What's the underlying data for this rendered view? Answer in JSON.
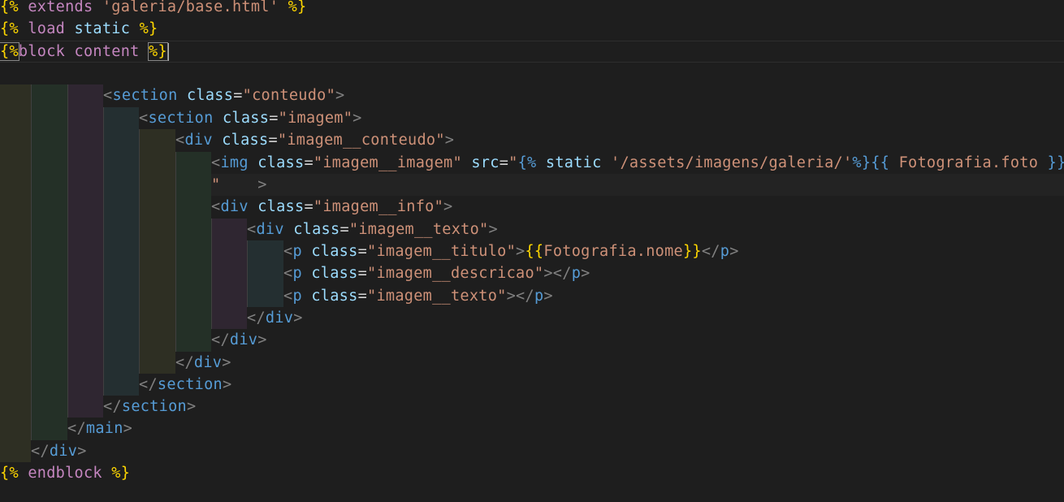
{
  "editor": {
    "lines": [
      {
        "tokens": [
          {
            "t": "{% ",
            "c": "tmpl"
          },
          {
            "t": "extends ",
            "c": "tmpl-kw"
          },
          {
            "t": "'galeria/base.html'",
            "c": "tmpl-str"
          },
          {
            "t": " %}",
            "c": "tmpl"
          }
        ]
      },
      {
        "tokens": [
          {
            "t": "{% ",
            "c": "tmpl"
          },
          {
            "t": "load ",
            "c": "tmpl-kw"
          },
          {
            "t": "static",
            "c": "tmpl-var"
          },
          {
            "t": " %}",
            "c": "tmpl"
          }
        ]
      },
      {
        "tokens": [
          {
            "t": "{%",
            "c": "tmpl"
          },
          {
            "t": "block ",
            "c": "tmpl-kw"
          },
          {
            "t": "content ",
            "c": "tmpl-kw"
          },
          {
            "t": "%}",
            "c": "tmpl"
          }
        ]
      },
      {
        "tokens": []
      },
      {
        "tokens": [
          {
            "t": "<",
            "c": "punc"
          },
          {
            "t": "section",
            "c": "kw-tag"
          },
          {
            "t": " ",
            "c": "plain"
          },
          {
            "t": "class",
            "c": "attr"
          },
          {
            "t": "=",
            "c": "plain"
          },
          {
            "t": "\"conteudo\"",
            "c": "str"
          },
          {
            "t": ">",
            "c": "punc"
          }
        ]
      },
      {
        "tokens": [
          {
            "t": "<",
            "c": "punc"
          },
          {
            "t": "section",
            "c": "kw-tag"
          },
          {
            "t": " ",
            "c": "plain"
          },
          {
            "t": "class",
            "c": "attr"
          },
          {
            "t": "=",
            "c": "plain"
          },
          {
            "t": "\"imagem\"",
            "c": "str"
          },
          {
            "t": ">",
            "c": "punc"
          }
        ]
      },
      {
        "tokens": [
          {
            "t": "<",
            "c": "punc"
          },
          {
            "t": "div",
            "c": "kw-tag"
          },
          {
            "t": " ",
            "c": "plain"
          },
          {
            "t": "class",
            "c": "attr"
          },
          {
            "t": "=",
            "c": "plain"
          },
          {
            "t": "\"imagem__conteudo\"",
            "c": "str"
          },
          {
            "t": ">",
            "c": "punc"
          }
        ]
      },
      {
        "tokens": [
          {
            "t": "<",
            "c": "punc"
          },
          {
            "t": "img",
            "c": "kw-tag"
          },
          {
            "t": " ",
            "c": "plain"
          },
          {
            "t": "class",
            "c": "attr"
          },
          {
            "t": "=",
            "c": "plain"
          },
          {
            "t": "\"imagem__imagem\"",
            "c": "str"
          },
          {
            "t": " ",
            "c": "plain"
          },
          {
            "t": "src",
            "c": "attr"
          },
          {
            "t": "=",
            "c": "plain"
          },
          {
            "t": "\"",
            "c": "str"
          },
          {
            "t": "{% ",
            "c": "kw-tag"
          },
          {
            "t": "static ",
            "c": "attr"
          },
          {
            "t": "'/assets/imagens/galeria/'",
            "c": "str"
          },
          {
            "t": "%}",
            "c": "kw-tag"
          },
          {
            "t": "{{ ",
            "c": "kw-tag"
          },
          {
            "t": "Fotografia.foto",
            "c": "str"
          },
          {
            "t": " }}",
            "c": "kw-tag"
          }
        ]
      },
      {
        "tokens": [
          {
            "t": "\"",
            "c": "str"
          },
          {
            "t": "    ",
            "c": "plain"
          },
          {
            "t": ">",
            "c": "punc"
          }
        ]
      },
      {
        "tokens": [
          {
            "t": "<",
            "c": "punc"
          },
          {
            "t": "div",
            "c": "kw-tag"
          },
          {
            "t": " ",
            "c": "plain"
          },
          {
            "t": "class",
            "c": "attr"
          },
          {
            "t": "=",
            "c": "plain"
          },
          {
            "t": "\"imagem__info\"",
            "c": "str"
          },
          {
            "t": ">",
            "c": "punc"
          }
        ]
      },
      {
        "tokens": [
          {
            "t": "<",
            "c": "punc"
          },
          {
            "t": "div",
            "c": "kw-tag"
          },
          {
            "t": " ",
            "c": "plain"
          },
          {
            "t": "class",
            "c": "attr"
          },
          {
            "t": "=",
            "c": "plain"
          },
          {
            "t": "\"imagem__texto\"",
            "c": "str"
          },
          {
            "t": ">",
            "c": "punc"
          }
        ]
      },
      {
        "tokens": [
          {
            "t": "<",
            "c": "punc"
          },
          {
            "t": "p",
            "c": "kw-tag"
          },
          {
            "t": " ",
            "c": "plain"
          },
          {
            "t": "class",
            "c": "attr"
          },
          {
            "t": "=",
            "c": "plain"
          },
          {
            "t": "\"imagem__titulo\"",
            "c": "str"
          },
          {
            "t": ">",
            "c": "punc"
          },
          {
            "t": "{{",
            "c": "tmpl"
          },
          {
            "t": "Fotografia.nome",
            "c": "str"
          },
          {
            "t": "}}",
            "c": "tmpl"
          },
          {
            "t": "</",
            "c": "punc"
          },
          {
            "t": "p",
            "c": "kw-tag"
          },
          {
            "t": ">",
            "c": "punc"
          }
        ]
      },
      {
        "tokens": [
          {
            "t": "<",
            "c": "punc"
          },
          {
            "t": "p",
            "c": "kw-tag"
          },
          {
            "t": " ",
            "c": "plain"
          },
          {
            "t": "class",
            "c": "attr"
          },
          {
            "t": "=",
            "c": "plain"
          },
          {
            "t": "\"imagem__descricao\"",
            "c": "str"
          },
          {
            "t": ">",
            "c": "punc"
          },
          {
            "t": "</",
            "c": "punc"
          },
          {
            "t": "p",
            "c": "kw-tag"
          },
          {
            "t": ">",
            "c": "punc"
          }
        ]
      },
      {
        "tokens": [
          {
            "t": "<",
            "c": "punc"
          },
          {
            "t": "p",
            "c": "kw-tag"
          },
          {
            "t": " ",
            "c": "plain"
          },
          {
            "t": "class",
            "c": "attr"
          },
          {
            "t": "=",
            "c": "plain"
          },
          {
            "t": "\"imagem__texto\"",
            "c": "str"
          },
          {
            "t": ">",
            "c": "punc"
          },
          {
            "t": "</",
            "c": "punc"
          },
          {
            "t": "p",
            "c": "kw-tag"
          },
          {
            "t": ">",
            "c": "punc"
          }
        ]
      },
      {
        "tokens": [
          {
            "t": "</",
            "c": "punc"
          },
          {
            "t": "div",
            "c": "kw-tag"
          },
          {
            "t": ">",
            "c": "punc"
          }
        ]
      },
      {
        "tokens": [
          {
            "t": "</",
            "c": "punc"
          },
          {
            "t": "div",
            "c": "kw-tag"
          },
          {
            "t": ">",
            "c": "punc"
          }
        ]
      },
      {
        "tokens": [
          {
            "t": "</",
            "c": "punc"
          },
          {
            "t": "div",
            "c": "kw-tag"
          },
          {
            "t": ">",
            "c": "punc"
          }
        ]
      },
      {
        "tokens": [
          {
            "t": "</",
            "c": "punc"
          },
          {
            "t": "section",
            "c": "kw-tag"
          },
          {
            "t": ">",
            "c": "punc"
          }
        ]
      },
      {
        "tokens": [
          {
            "t": "</",
            "c": "punc"
          },
          {
            "t": "section",
            "c": "kw-tag"
          },
          {
            "t": ">",
            "c": "punc"
          }
        ]
      },
      {
        "tokens": [
          {
            "t": "</",
            "c": "punc"
          },
          {
            "t": "main",
            "c": "kw-tag"
          },
          {
            "t": ">",
            "c": "punc"
          }
        ]
      },
      {
        "tokens": [
          {
            "t": "</",
            "c": "punc"
          },
          {
            "t": "div",
            "c": "kw-tag"
          },
          {
            "t": ">",
            "c": "punc"
          }
        ]
      },
      {
        "tokens": [
          {
            "t": "{% ",
            "c": "tmpl"
          },
          {
            "t": "endblock ",
            "c": "tmpl-kw"
          },
          {
            "t": "%}",
            "c": "tmpl"
          }
        ]
      }
    ],
    "colors": {
      "background": "#1e1e1e",
      "guide_yellow": "#2e2f23",
      "guide_green": "#243027",
      "guide_purple": "#2f2631",
      "guide_teal": "#242f31"
    }
  }
}
